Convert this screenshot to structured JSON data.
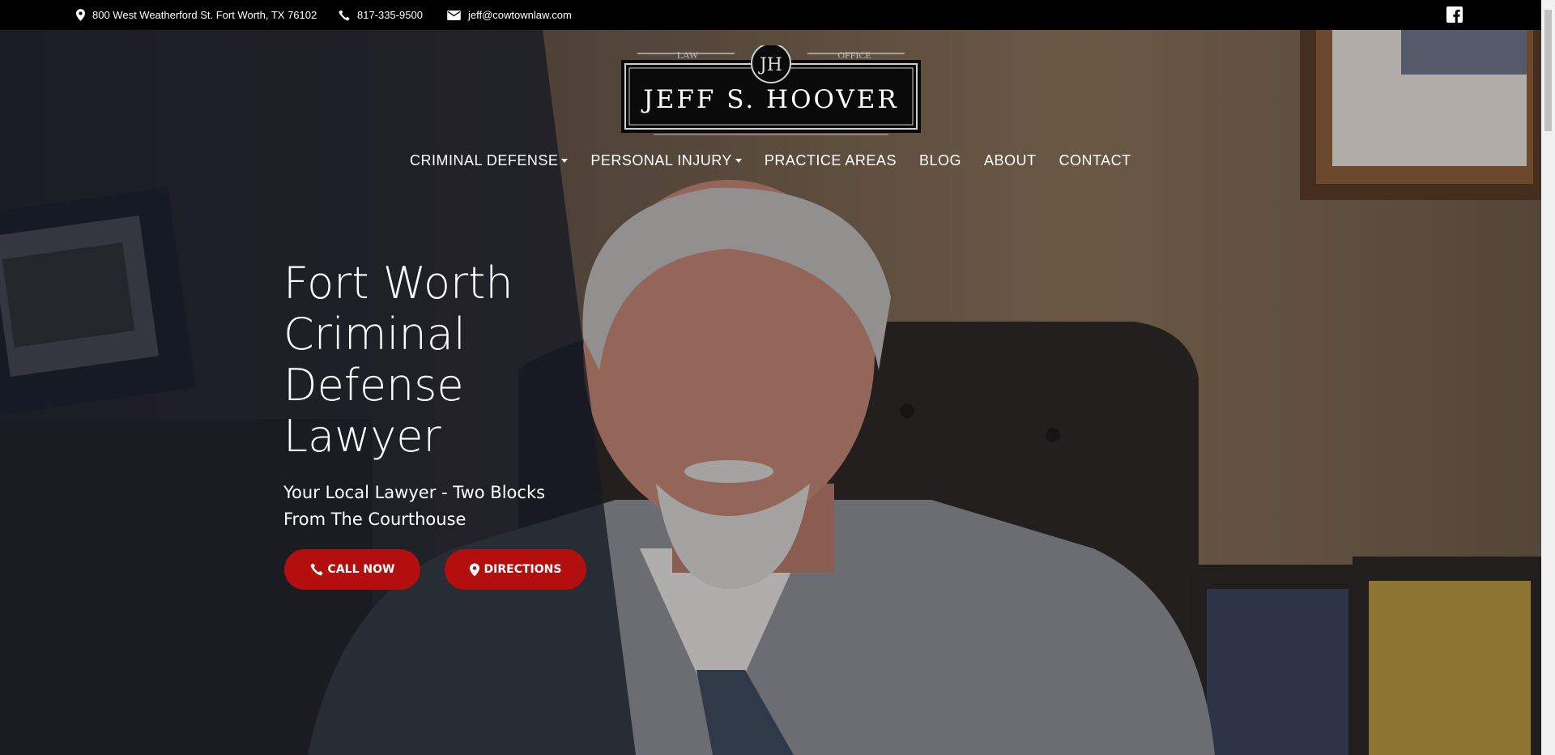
{
  "topbar": {
    "address": "800 West Weatherford St. Fort Worth, TX 76102",
    "phone": "817-335-9500",
    "email": "jeff@cowtownlaw.com",
    "address_icon": "map-pin-icon",
    "phone_icon": "phone-icon",
    "email_icon": "envelope-icon",
    "social_icon": "facebook-icon"
  },
  "logo": {
    "top_left": "LAW",
    "top_right": "OFFICE",
    "monogram": "JH",
    "name": "JEFF S. HOOVER"
  },
  "nav": {
    "items": [
      {
        "label": "CRIMINAL DEFENSE",
        "has_dropdown": true
      },
      {
        "label": "PERSONAL INJURY",
        "has_dropdown": true
      },
      {
        "label": "PRACTICE AREAS",
        "has_dropdown": false
      },
      {
        "label": "BLOG",
        "has_dropdown": false
      },
      {
        "label": "ABOUT",
        "has_dropdown": false
      },
      {
        "label": "CONTACT",
        "has_dropdown": false
      }
    ]
  },
  "hero": {
    "headline_lines": [
      "Fort Worth",
      "Criminal",
      "Defense",
      "Lawyer"
    ],
    "subhead_lines": [
      "Your Local Lawyer - Two Blocks",
      "From The Courthouse"
    ],
    "call_label": "CALL NOW",
    "directions_label": "DIRECTIONS"
  },
  "colors": {
    "topbar_bg": "#000000",
    "button_red": "#b30f0f",
    "overlay": "#161a24"
  }
}
